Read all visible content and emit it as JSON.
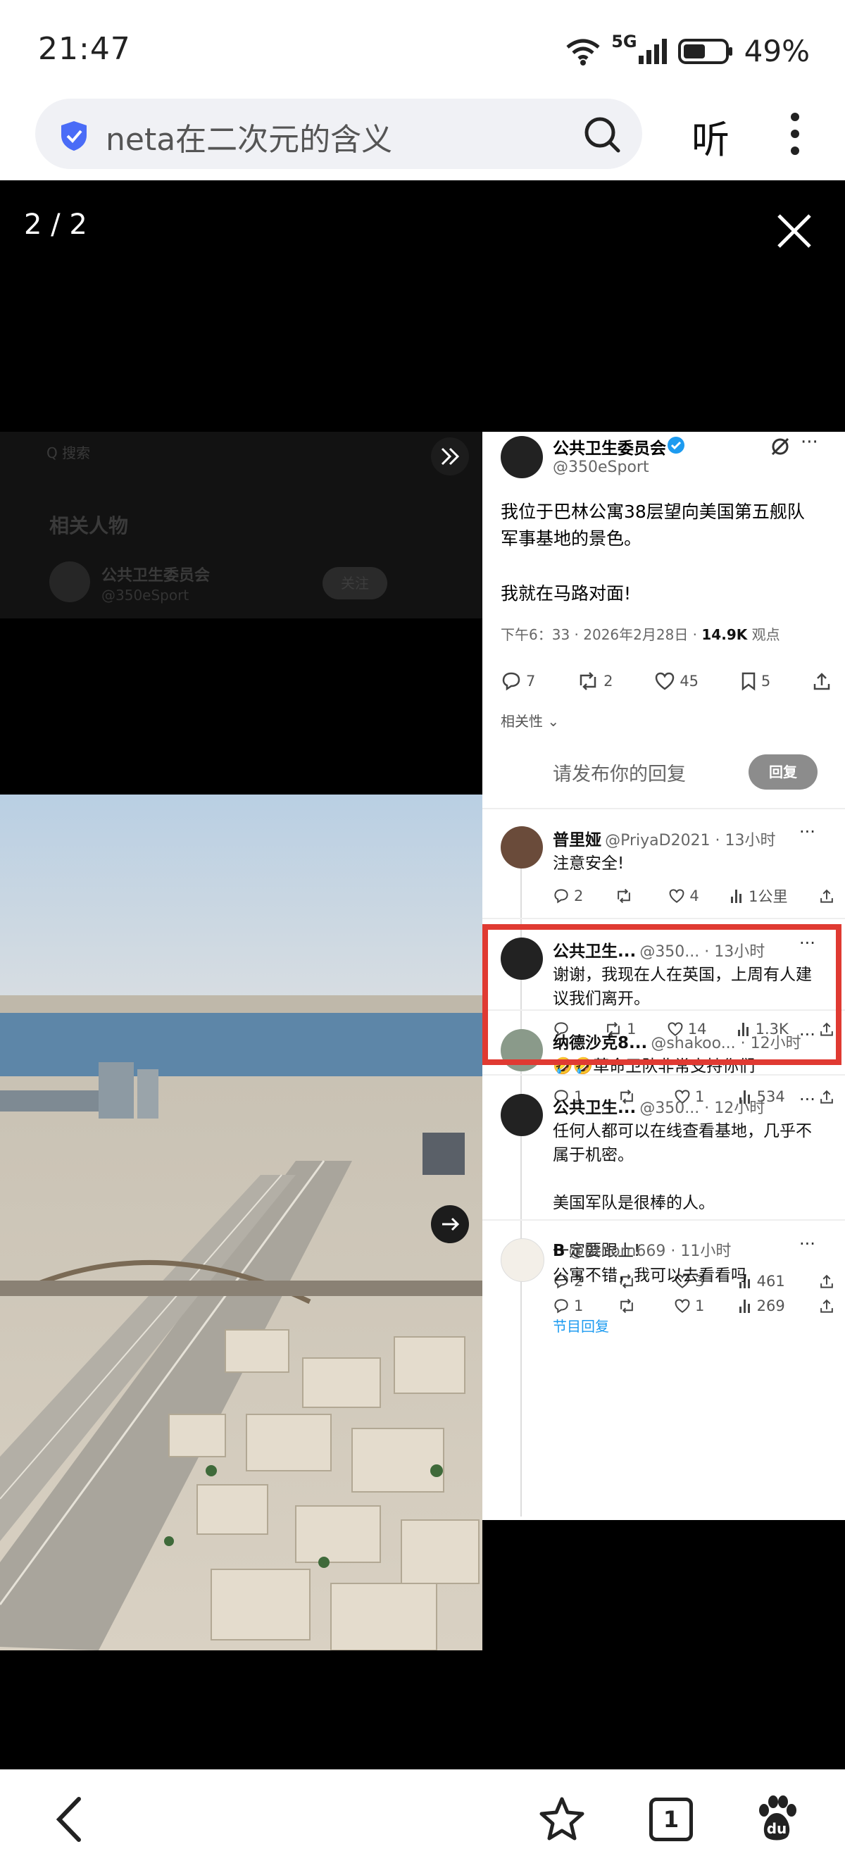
{
  "status": {
    "time": "21:47",
    "network": "5G",
    "battery": "49%"
  },
  "browser": {
    "search_text": "neta在二次元的含义",
    "listen_label": "听",
    "tab_count": "1"
  },
  "viewer": {
    "counter": "2 / 2"
  },
  "left_overlay": {
    "search_hint": "Q 搜索",
    "related_title": "相关人物",
    "related_name": "公共卫生委员会",
    "related_handle": "@350eSport",
    "follow_label": "关注"
  },
  "post": {
    "author": "公共卫生委员会",
    "handle": "@350eSport",
    "text1": "我位于巴林公寓38层望向美国第五舰队",
    "text2": "军事基地的景色。",
    "text3": "我就在马路对面!",
    "time": "下午6：33 · 2026年2月28日 · ",
    "views": "14.9K",
    "views_label": "观点",
    "replies": "7",
    "reposts": "2",
    "likes": "45",
    "bookmarks": "5",
    "sort_label": "相关性",
    "reply_placeholder": "请发布你的回复",
    "reply_button": "回复"
  },
  "replies": [
    {
      "name": "普里娅",
      "handle": "@PriyaD2021 · 13小时",
      "lines": [
        "注意安全!"
      ],
      "replies": "2",
      "reposts": "",
      "likes": "4",
      "views": "1公里"
    },
    {
      "name": "公共卫生...",
      "handle": "@350... · 13小时",
      "lines": [
        "谢谢，我现在人在英国，上周有人建",
        "议我们离开。"
      ],
      "replies": "",
      "reposts": "1",
      "likes": "14",
      "views": "1.3K"
    },
    {
      "name": "纳德沙克8...",
      "handle": "@shakoo... · 12小时",
      "lines": [
        "🤣🤣革命卫队非常支持你们"
      ],
      "replies": "1",
      "reposts": "",
      "likes": "1",
      "views": "534"
    },
    {
      "name": "公共卫生...",
      "handle": "@350... · 12小时",
      "lines": [
        "任何人都可以在线查看基地，几乎不",
        "属于机密。",
        "",
        "美国军队是很棒的人。",
        "",
        "一定要跟上!"
      ],
      "replies": "2",
      "reposts": "",
      "likes": "3",
      "views": "461",
      "show_replies": "节目回复"
    },
    {
      "name": "B",
      "handle": "@Bthorn669 · 11小时",
      "lines": [
        "公寓不错，我可以去看看吗"
      ],
      "replies": "1",
      "reposts": "",
      "likes": "1",
      "views": "269"
    }
  ],
  "colors": {
    "highlight": "#e03a32",
    "verified": "#1d9bf0",
    "urlbar": "#f0f1f5"
  }
}
